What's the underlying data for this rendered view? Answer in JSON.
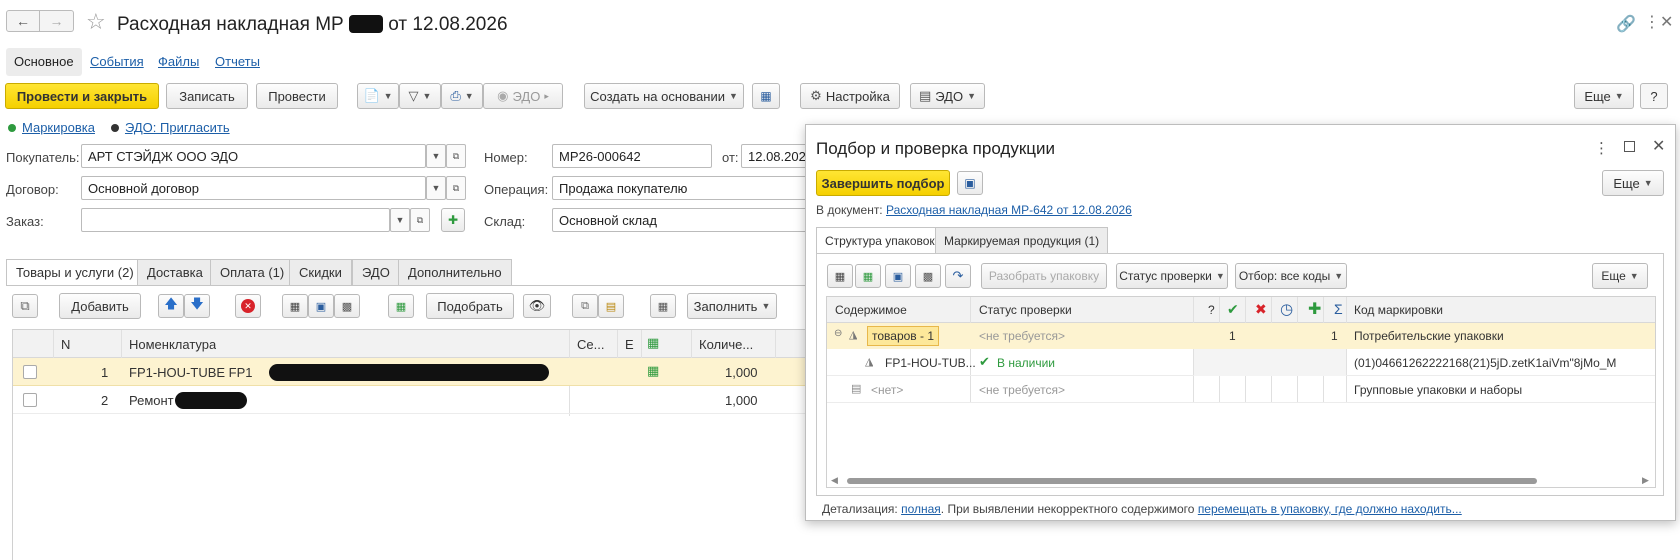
{
  "window": {
    "title_prefix": "Расходная накладная МР",
    "title_suffix": "от 12.08.2026",
    "nav_tabs": [
      "Основное",
      "События",
      "Файлы",
      "Отчеты"
    ]
  },
  "toolbar": {
    "post_close": "Провести и закрыть",
    "save": "Записать",
    "post": "Провести",
    "edo_dim": "ЭДО",
    "create_basis": "Создать на основании",
    "settings": "Настройка",
    "edo": "ЭДО",
    "more": "Еще"
  },
  "status": {
    "marking": "Маркировка",
    "edo_invite": "ЭДО: Пригласить",
    "marking_color": "#2e9a3e",
    "edo_color": "#333333"
  },
  "form": {
    "buyer_label": "Покупатель:",
    "buyer_value": "АРТ СТЭЙДЖ ООО ЭДО",
    "contract_label": "Договор:",
    "contract_value": "Основной договор",
    "order_label": "Заказ:",
    "order_value": "",
    "number_label": "Номер:",
    "number_value": "МР26-000642",
    "date_label": "от:",
    "date_value": "12.08.2026",
    "operation_label": "Операция:",
    "operation_value": "Продажа покупателю",
    "warehouse_label": "Склад:",
    "warehouse_value": "Основной склад"
  },
  "goods_tabs": [
    "Товары и услуги (2)",
    "Доставка",
    "Оплата (1)",
    "Скидки",
    "ЭДО",
    "Дополнительно"
  ],
  "goods_toolbar": {
    "add": "Добавить",
    "pick": "Подобрать",
    "fill": "Заполнить"
  },
  "goods_table": {
    "headers": [
      "N",
      "Номенклатура",
      "Се...",
      "Е",
      "Количе..."
    ],
    "rows": [
      {
        "n": "1",
        "name": "FP1-HOU-TUBE FP1",
        "qty": "1,000"
      },
      {
        "n": "2",
        "name": "Ремонт",
        "qty": "1,000"
      }
    ]
  },
  "dialog": {
    "title": "Подбор и проверка продукции",
    "finish": "Завершить подбор",
    "more": "Еще",
    "doc_label": "В документ:",
    "doc_link": "Расходная накладная МР-642 от 12.08.2026",
    "tabs": [
      "Структура упаковок",
      "Маркируемая продукция (1)"
    ],
    "toolbar": {
      "unpack": "Разобрать упаковку",
      "check_status": "Статус проверки",
      "filter": "Отбор: все коды",
      "more": "Еще"
    },
    "table": {
      "headers": {
        "content": "Содержимое",
        "status": "Статус проверки",
        "question": "?",
        "sigma": "Σ",
        "code": "Код маркировки"
      },
      "rows": [
        {
          "content": "товаров - 1",
          "status": "<не требуется>",
          "ok": "1",
          "sum": "1",
          "code": "Потребительские упаковки"
        },
        {
          "content": "FP1-HOU-TUB...",
          "status": "В наличии",
          "code": "(01)04661262222168(21)5jD.zetK1aiVm\"8jMo_M"
        },
        {
          "content": "<нет>",
          "status": "<не требуется>",
          "code": "Групповые упаковки и наборы"
        }
      ]
    },
    "footer": {
      "detail_label": "Детализация:",
      "detail_link": "полная",
      "detail_text": ". При выявлении некорректного содержимого",
      "detail_link2": "перемещать в упаковку, где должно находить..."
    }
  }
}
